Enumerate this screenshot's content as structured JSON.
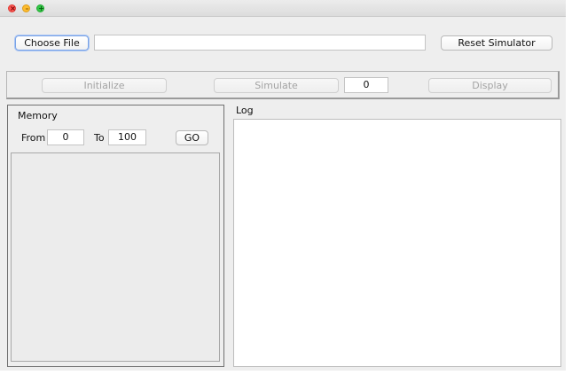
{
  "window": {
    "controls": {
      "close": "close-icon",
      "minimize": "minimize-icon",
      "maximize": "maximize-icon",
      "close_glyph": "×",
      "minimize_glyph": "–",
      "maximize_glyph": "+"
    }
  },
  "file_row": {
    "choose_file_label": "Choose File",
    "file_path_value": "",
    "reset_label": "Reset Simulator"
  },
  "simulation_bar": {
    "initialize_label": "Initialize",
    "simulate_label": "Simulate",
    "step_count_value": "0",
    "display_label": "Display"
  },
  "memory": {
    "title": "Memory",
    "from_label": "From",
    "from_value": "0",
    "to_label": "To",
    "to_value": "100",
    "go_label": "GO"
  },
  "log": {
    "title": "Log",
    "content": ""
  }
}
